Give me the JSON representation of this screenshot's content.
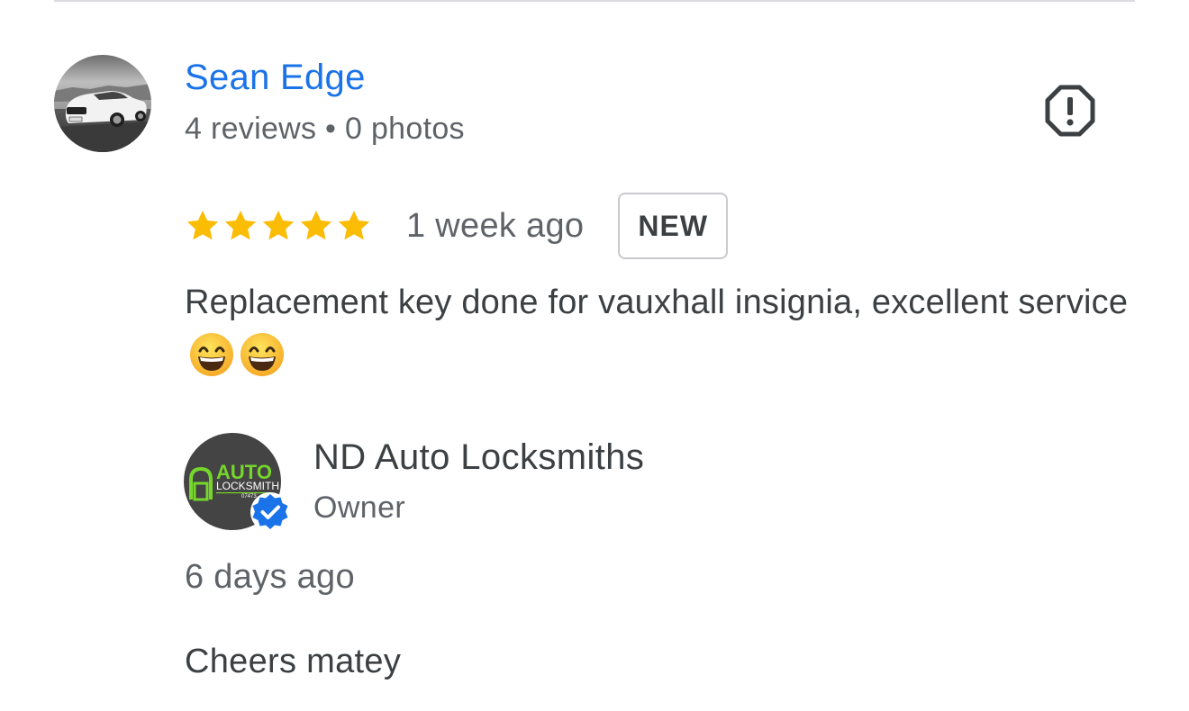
{
  "review": {
    "reviewer_name": "Sean Edge",
    "reviewer_meta": "4 reviews • 0 photos",
    "rating": 5,
    "rating_max": 5,
    "time_ago": "1 week ago",
    "badge": "NEW",
    "text": "Replacement key done for vauxhall insignia, excellent service",
    "emojis": [
      "grinning-face-with-smiling-eyes",
      "grinning-face-with-smiling-eyes"
    ]
  },
  "owner_reply": {
    "name": "ND Auto Locksmiths",
    "role": "Owner",
    "logo_text": {
      "auto": "AUTO",
      "locksmith": "LOCKSMITH",
      "number": "07473"
    },
    "time_ago": "6 days ago",
    "text": "Cheers matey"
  },
  "colors": {
    "link": "#1a73e8",
    "star": "#fbbc04",
    "verified": "#1a73e8",
    "logo_green": "#76d62b"
  }
}
